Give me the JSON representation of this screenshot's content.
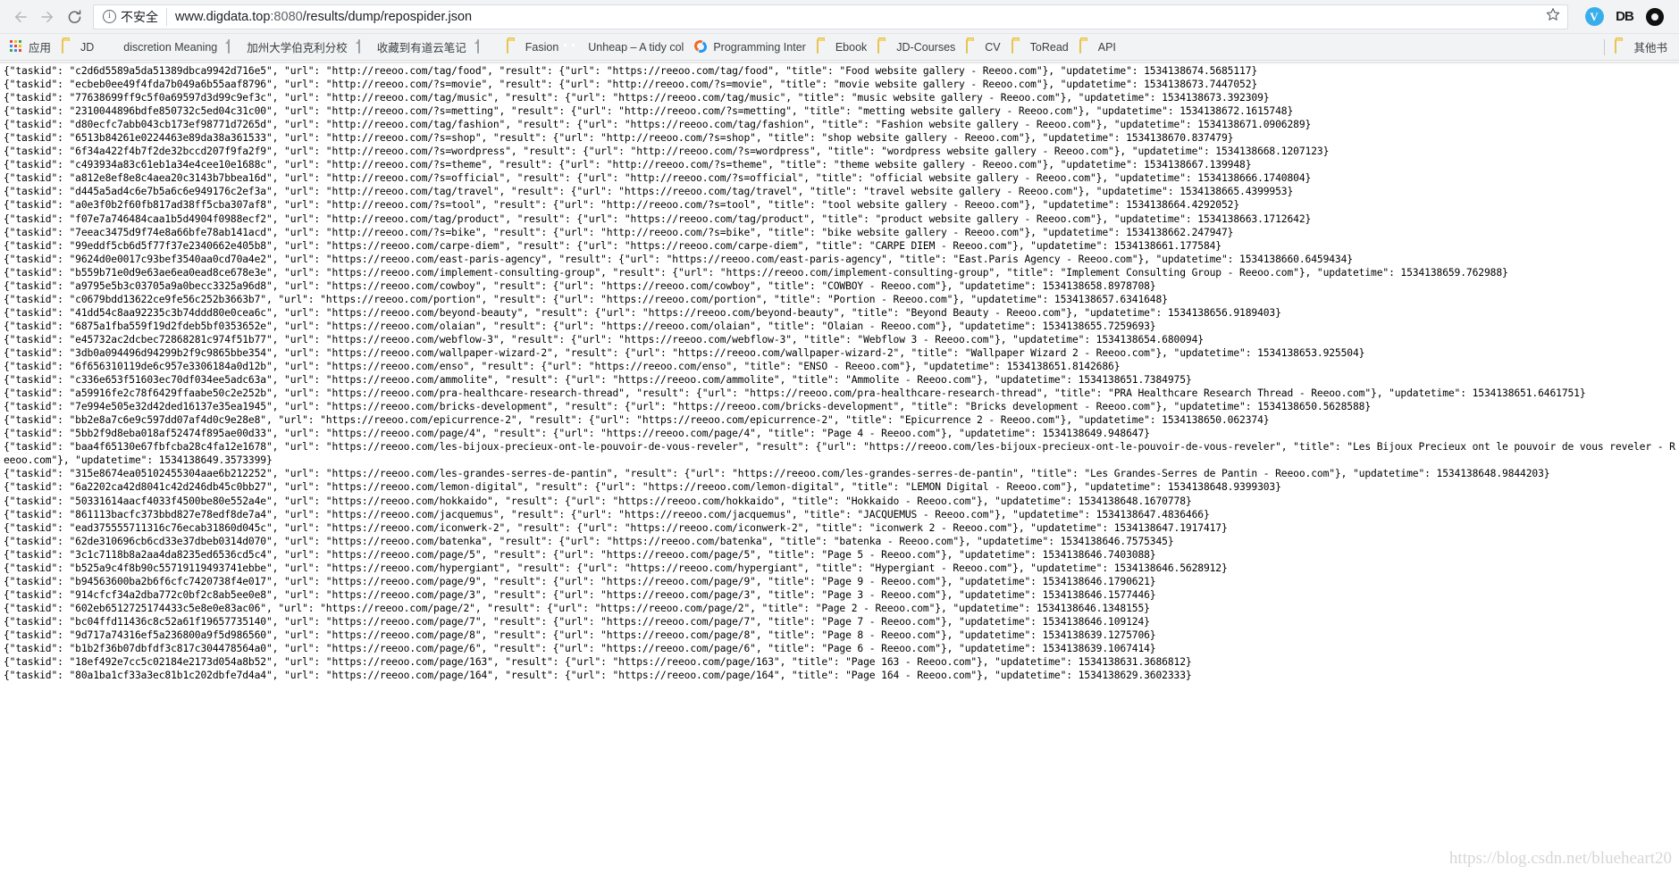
{
  "browser": {
    "back_icon": "back-arrow-icon",
    "forward_icon": "forward-arrow-icon",
    "reload_icon": "reload-icon",
    "security_label": "不安全",
    "url_host": "www.digdata.top",
    "url_port": ":8080",
    "url_path": "/results/dump/repospider.json",
    "star_icon": "bookmark-star-icon",
    "extensions": [
      {
        "name": "vimium-extension",
        "glyph": "V"
      },
      {
        "name": "db-extension",
        "glyph": "DB"
      },
      {
        "name": "opera-extension",
        "glyph": "O"
      }
    ]
  },
  "bookmarks": {
    "apps_label": "应用",
    "items": [
      {
        "label": "JD",
        "icon": "folder-icon"
      },
      {
        "label": "discretion Meaning",
        "icon": "shield-icon"
      },
      {
        "label": "加州大学伯克利分校",
        "icon": "page-icon"
      },
      {
        "label": "收藏到有道云笔记",
        "icon": "page-icon"
      },
      {
        "label": "",
        "icon": "page-icon"
      },
      {
        "label": "Fasion",
        "icon": "folder-icon"
      },
      {
        "label": "Unheap – A tidy col",
        "icon": "unheap-icon"
      },
      {
        "label": "Programming Inter",
        "icon": "programming-icon"
      },
      {
        "label": "Ebook",
        "icon": "folder-icon"
      },
      {
        "label": "JD-Courses",
        "icon": "folder-icon"
      },
      {
        "label": "CV",
        "icon": "folder-icon"
      },
      {
        "label": "ToRead",
        "icon": "folder-icon"
      },
      {
        "label": "API",
        "icon": "folder-icon"
      }
    ],
    "overflow": {
      "label": "其他书",
      "icon": "folder-icon"
    }
  },
  "page": {
    "watermark": "https://blog.csdn.net/blueheart20",
    "json_text": "{\"taskid\": \"c2d6d5589a5da51389dbca9942d716e5\", \"url\": \"http://reeoo.com/tag/food\", \"result\": {\"url\": \"https://reeoo.com/tag/food\", \"title\": \"Food website gallery - Reeoo.com\"}, \"updatetime\": 1534138674.5685117}\n{\"taskid\": \"ecbeb0ee49f4fda7b049a6b55aaf8796\", \"url\": \"http://reeoo.com/?s=movie\", \"result\": {\"url\": \"http://reeoo.com/?s=movie\", \"title\": \"movie website gallery - Reeoo.com\"}, \"updatetime\": 1534138673.7447052}\n{\"taskid\": \"77638699ff9c5f0a69597d3d99c9ef3c\", \"url\": \"http://reeoo.com/tag/music\", \"result\": {\"url\": \"https://reeoo.com/tag/music\", \"title\": \"music website gallery - Reeoo.com\"}, \"updatetime\": 1534138673.392309}\n{\"taskid\": \"2310044896bdfe850732c5ed04c31c00\", \"url\": \"http://reeoo.com/?s=metting\", \"result\": {\"url\": \"http://reeoo.com/?s=metting\", \"title\": \"metting website gallery - Reeoo.com\"}, \"updatetime\": 1534138672.1615748}\n{\"taskid\": \"d80ecfc7abb043cb173ef98771d7265d\", \"url\": \"http://reeoo.com/tag/fashion\", \"result\": {\"url\": \"https://reeoo.com/tag/fashion\", \"title\": \"Fashion website gallery - Reeoo.com\"}, \"updatetime\": 1534138671.0906289}\n{\"taskid\": \"6513b84261e0224463e89da38a361533\", \"url\": \"http://reeoo.com/?s=shop\", \"result\": {\"url\": \"http://reeoo.com/?s=shop\", \"title\": \"shop website gallery - Reeoo.com\"}, \"updatetime\": 1534138670.837479}\n{\"taskid\": \"6f34a422f4b7f2de32bccd207f9fa2f9\", \"url\": \"http://reeoo.com/?s=wordpress\", \"result\": {\"url\": \"http://reeoo.com/?s=wordpress\", \"title\": \"wordpress website gallery - Reeoo.com\"}, \"updatetime\": 1534138668.1207123}\n{\"taskid\": \"c493934a83c61eb1a34e4cee10e1688c\", \"url\": \"http://reeoo.com/?s=theme\", \"result\": {\"url\": \"http://reeoo.com/?s=theme\", \"title\": \"theme website gallery - Reeoo.com\"}, \"updatetime\": 1534138667.139948}\n{\"taskid\": \"a812e8ef8e8c4aea20c3143b7bbea16d\", \"url\": \"http://reeoo.com/?s=official\", \"result\": {\"url\": \"http://reeoo.com/?s=official\", \"title\": \"official website gallery - Reeoo.com\"}, \"updatetime\": 1534138666.1740804}\n{\"taskid\": \"d445a5ad4c6e7b5a6c6e949176c2ef3a\", \"url\": \"http://reeoo.com/tag/travel\", \"result\": {\"url\": \"https://reeoo.com/tag/travel\", \"title\": \"travel website gallery - Reeoo.com\"}, \"updatetime\": 1534138665.4399953}\n{\"taskid\": \"a0e3f0b2f60fb817ad38ff5cba307af8\", \"url\": \"http://reeoo.com/?s=tool\", \"result\": {\"url\": \"http://reeoo.com/?s=tool\", \"title\": \"tool website gallery - Reeoo.com\"}, \"updatetime\": 1534138664.4292052}\n{\"taskid\": \"f07e7a746484caa1b5d4904f0988ecf2\", \"url\": \"http://reeoo.com/tag/product\", \"result\": {\"url\": \"https://reeoo.com/tag/product\", \"title\": \"product website gallery - Reeoo.com\"}, \"updatetime\": 1534138663.1712642}\n{\"taskid\": \"7eeac3475d9f74e8a66bfe78ab141acd\", \"url\": \"http://reeoo.com/?s=bike\", \"result\": {\"url\": \"http://reeoo.com/?s=bike\", \"title\": \"bike website gallery - Reeoo.com\"}, \"updatetime\": 1534138662.247947}\n{\"taskid\": \"99eddf5cb6d5f77f37e2340662e405b8\", \"url\": \"https://reeoo.com/carpe-diem\", \"result\": {\"url\": \"https://reeoo.com/carpe-diem\", \"title\": \"CARPE DIEM - Reeoo.com\"}, \"updatetime\": 1534138661.177584}\n{\"taskid\": \"9624d0e0017c93bef3540aa0cd70a4e2\", \"url\": \"https://reeoo.com/east-paris-agency\", \"result\": {\"url\": \"https://reeoo.com/east-paris-agency\", \"title\": \"East.Paris Agency - Reeoo.com\"}, \"updatetime\": 1534138660.6459434}\n{\"taskid\": \"b559b71e0d9e63ae6ea0ead8ce678e3e\", \"url\": \"https://reeoo.com/implement-consulting-group\", \"result\": {\"url\": \"https://reeoo.com/implement-consulting-group\", \"title\": \"Implement Consulting Group - Reeoo.com\"}, \"updatetime\": 1534138659.762988}\n{\"taskid\": \"a9795e5b3c03705a9a0becc3325a96d8\", \"url\": \"https://reeoo.com/cowboy\", \"result\": {\"url\": \"https://reeoo.com/cowboy\", \"title\": \"COWBOY - Reeoo.com\"}, \"updatetime\": 1534138658.8978708}\n{\"taskid\": \"c0679bdd13622ce9fe56c252b3663b7\", \"url\": \"https://reeoo.com/portion\", \"result\": {\"url\": \"https://reeoo.com/portion\", \"title\": \"Portion - Reeoo.com\"}, \"updatetime\": 1534138657.6341648}\n{\"taskid\": \"41dd54c8aa92235c3b74ddd80e0cea6c\", \"url\": \"https://reeoo.com/beyond-beauty\", \"result\": {\"url\": \"https://reeoo.com/beyond-beauty\", \"title\": \"Beyond Beauty - Reeoo.com\"}, \"updatetime\": 1534138656.9189403}\n{\"taskid\": \"6875a1fba559f19d2fdeb5bf0353652e\", \"url\": \"https://reeoo.com/olaian\", \"result\": {\"url\": \"https://reeoo.com/olaian\", \"title\": \"Olaian - Reeoo.com\"}, \"updatetime\": 1534138655.7259693}\n{\"taskid\": \"e45732ac2dcbec72868281c974f51b77\", \"url\": \"https://reeoo.com/webflow-3\", \"result\": {\"url\": \"https://reeoo.com/webflow-3\", \"title\": \"Webflow 3 - Reeoo.com\"}, \"updatetime\": 1534138654.680094}\n{\"taskid\": \"3db0a094496d94299b2f9c9865bbe354\", \"url\": \"https://reeoo.com/wallpaper-wizard-2\", \"result\": {\"url\": \"https://reeoo.com/wallpaper-wizard-2\", \"title\": \"Wallpaper Wizard 2 - Reeoo.com\"}, \"updatetime\": 1534138653.925504}\n{\"taskid\": \"6f656310119de6c957e3306184a0d12b\", \"url\": \"https://reeoo.com/enso\", \"result\": {\"url\": \"https://reeoo.com/enso\", \"title\": \"ENSO - Reeoo.com\"}, \"updatetime\": 1534138651.8142686}\n{\"taskid\": \"c336e653f51603ec70df034ee5adc63a\", \"url\": \"https://reeoo.com/ammolite\", \"result\": {\"url\": \"https://reeoo.com/ammolite\", \"title\": \"Ammolite - Reeoo.com\"}, \"updatetime\": 1534138651.7384975}\n{\"taskid\": \"a59916fe2c78f6429ffaabe50c2e252b\", \"url\": \"https://reeoo.com/pra-healthcare-research-thread\", \"result\": {\"url\": \"https://reeoo.com/pra-healthcare-research-thread\", \"title\": \"PRA Healthcare Research Thread - Reeoo.com\"}, \"updatetime\": 1534138651.6461751}\n{\"taskid\": \"7e994e505e32d42ded16137e35ea1945\", \"url\": \"https://reeoo.com/bricks-development\", \"result\": {\"url\": \"https://reeoo.com/bricks-development\", \"title\": \"Bricks development - Reeoo.com\"}, \"updatetime\": 1534138650.5628588}\n{\"taskid\": \"bb2e8a7c6e9c597dd07af4d0c9e28e8\", \"url\": \"https://reeoo.com/epicurrence-2\", \"result\": {\"url\": \"https://reeoo.com/epicurrence-2\", \"title\": \"Epicurrence 2 - Reeoo.com\"}, \"updatetime\": 1534138650.062374}\n{\"taskid\": \"5bb2f9d8eba018af52474f895ae00d33\", \"url\": \"https://reeoo.com/page/4\", \"result\": {\"url\": \"https://reeoo.com/page/4\", \"title\": \"Page 4 - Reeoo.com\"}, \"updatetime\": 1534138649.948647}\n{\"taskid\": \"baa4f65130e67fbfcba28c4fa12e1678\", \"url\": \"https://reeoo.com/les-bijoux-precieux-ont-le-pouvoir-de-vous-reveler\", \"result\": {\"url\": \"https://reeoo.com/les-bijoux-precieux-ont-le-pouvoir-de-vous-reveler\", \"title\": \"Les Bijoux Precieux ont le pouvoir de vous reveler - Reeoo.com\"}, \"updatetime\": 1534138649.3573399}\n{\"taskid\": \"315e8674ea05102455304aae6b212252\", \"url\": \"https://reeoo.com/les-grandes-serres-de-pantin\", \"result\": {\"url\": \"https://reeoo.com/les-grandes-serres-de-pantin\", \"title\": \"Les Grandes-Serres de Pantin - Reeoo.com\"}, \"updatetime\": 1534138648.9844203}\n{\"taskid\": \"6a2202ca42d8041c42d246db45c0bb27\", \"url\": \"https://reeoo.com/lemon-digital\", \"result\": {\"url\": \"https://reeoo.com/lemon-digital\", \"title\": \"LEMON Digital - Reeoo.com\"}, \"updatetime\": 1534138648.9399303}\n{\"taskid\": \"50331614aacf4033f4500be80e552a4e\", \"url\": \"https://reeoo.com/hokkaido\", \"result\": {\"url\": \"https://reeoo.com/hokkaido\", \"title\": \"Hokkaido - Reeoo.com\"}, \"updatetime\": 1534138648.1670778}\n{\"taskid\": \"861113bacfc373bbd827e78edf8de7a4\", \"url\": \"https://reeoo.com/jacquemus\", \"result\": {\"url\": \"https://reeoo.com/jacquemus\", \"title\": \"JACQUEMUS - Reeoo.com\"}, \"updatetime\": 1534138647.4836466}\n{\"taskid\": \"ead375555711316c76ecab31860d045c\", \"url\": \"https://reeoo.com/iconwerk-2\", \"result\": {\"url\": \"https://reeoo.com/iconwerk-2\", \"title\": \"iconwerk 2 - Reeoo.com\"}, \"updatetime\": 1534138647.1917417}\n{\"taskid\": \"62de310696cb6cd33e37dbeb0314d070\", \"url\": \"https://reeoo.com/batenka\", \"result\": {\"url\": \"https://reeoo.com/batenka\", \"title\": \"batenka - Reeoo.com\"}, \"updatetime\": 1534138646.7575345}\n{\"taskid\": \"3c1c7118b8a2aa4da8235ed6536cd5c4\", \"url\": \"https://reeoo.com/page/5\", \"result\": {\"url\": \"https://reeoo.com/page/5\", \"title\": \"Page 5 - Reeoo.com\"}, \"updatetime\": 1534138646.7403088}\n{\"taskid\": \"b525a9c4f8b90c55719119493741ebbe\", \"url\": \"https://reeoo.com/hypergiant\", \"result\": {\"url\": \"https://reeoo.com/hypergiant\", \"title\": \"Hypergiant - Reeoo.com\"}, \"updatetime\": 1534138646.5628912}\n{\"taskid\": \"b94563600ba2b6f6cfc7420738f4e017\", \"url\": \"https://reeoo.com/page/9\", \"result\": {\"url\": \"https://reeoo.com/page/9\", \"title\": \"Page 9 - Reeoo.com\"}, \"updatetime\": 1534138646.1790621}\n{\"taskid\": \"914cfcf34a2dba772c0bf2c8ab5ee0e8\", \"url\": \"https://reeoo.com/page/3\", \"result\": {\"url\": \"https://reeoo.com/page/3\", \"title\": \"Page 3 - Reeoo.com\"}, \"updatetime\": 1534138646.1577446}\n{\"taskid\": \"602eb6512725174433c5e8e0e83ac06\", \"url\": \"https://reeoo.com/page/2\", \"result\": {\"url\": \"https://reeoo.com/page/2\", \"title\": \"Page 2 - Reeoo.com\"}, \"updatetime\": 1534138646.1348155}\n{\"taskid\": \"bc04ffd11436c8c52a61f19657735140\", \"url\": \"https://reeoo.com/page/7\", \"result\": {\"url\": \"https://reeoo.com/page/7\", \"title\": \"Page 7 - Reeoo.com\"}, \"updatetime\": 1534138646.109124}\n{\"taskid\": \"9d717a74316ef5a236800a9f5d986560\", \"url\": \"https://reeoo.com/page/8\", \"result\": {\"url\": \"https://reeoo.com/page/8\", \"title\": \"Page 8 - Reeoo.com\"}, \"updatetime\": 1534138639.1275706}\n{\"taskid\": \"b1b2f36b07dbfdf3c817c304478564a0\", \"url\": \"https://reeoo.com/page/6\", \"result\": {\"url\": \"https://reeoo.com/page/6\", \"title\": \"Page 6 - Reeoo.com\"}, \"updatetime\": 1534138639.1067414}\n{\"taskid\": \"18ef492e7cc5c02184e2173d054a8b52\", \"url\": \"https://reeoo.com/page/163\", \"result\": {\"url\": \"https://reeoo.com/page/163\", \"title\": \"Page 163 - Reeoo.com\"}, \"updatetime\": 1534138631.3686812}\n{\"taskid\": \"80a1ba1cf33a3ec81b1c202dbfe7d4a4\", \"url\": \"https://reeoo.com/page/164\", \"result\": {\"url\": \"https://reeoo.com/page/164\", \"title\": \"Page 164 - Reeoo.com\"}, \"updatetime\": 1534138629.3602333}\n"
  }
}
